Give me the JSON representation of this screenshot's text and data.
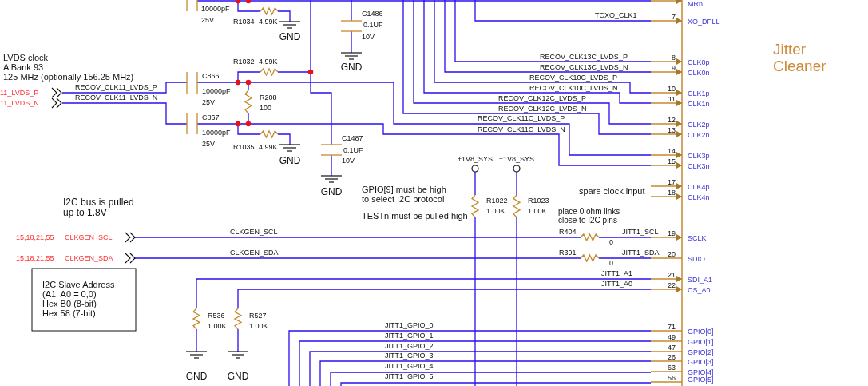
{
  "chip": {
    "title_lines": [
      "Jitter",
      "Cleaner"
    ],
    "pins": [
      {
        "name": "MRn",
        "kind": "input"
      },
      {
        "number": "7",
        "name": "XO_DPLL",
        "kind": "input"
      },
      {
        "number": "8",
        "name": "CLK0p",
        "kind": "input"
      },
      {
        "number": "9",
        "name": "CLK0n",
        "kind": "input"
      },
      {
        "number": "10",
        "name": "CLK1p",
        "kind": "input"
      },
      {
        "number": "11",
        "name": "CLK1n",
        "kind": "input"
      },
      {
        "number": "12",
        "name": "CLK2p",
        "kind": "input"
      },
      {
        "number": "13",
        "name": "CLK2n",
        "kind": "input"
      },
      {
        "number": "14",
        "name": "CLK3p",
        "kind": "input"
      },
      {
        "number": "15",
        "name": "CLK3n",
        "kind": "input"
      },
      {
        "number": "17",
        "name": "CLK4p",
        "kind": "input"
      },
      {
        "number": "18",
        "name": "CLK4n",
        "kind": "input"
      },
      {
        "number": "19",
        "name": "SCLK",
        "kind": "input"
      },
      {
        "number": "20",
        "name": "SDIO",
        "kind": "bidir"
      },
      {
        "number": "21",
        "name": "SDI_A1",
        "kind": "input"
      },
      {
        "number": "22",
        "name": "CS_A0",
        "kind": "input"
      },
      {
        "number": "71",
        "name": "GPIO[0]",
        "kind": "bidir"
      },
      {
        "number": "49",
        "name": "GPIO[1]",
        "kind": "bidir"
      },
      {
        "number": "47",
        "name": "GPIO[2]",
        "kind": "bidir"
      },
      {
        "number": "26",
        "name": "GPIO[3]",
        "kind": "bidir"
      },
      {
        "number": "63",
        "name": "GPIO[4]",
        "kind": "bidir"
      },
      {
        "number": "56",
        "name": "GPIO[5]",
        "kind": "bidir"
      }
    ]
  },
  "net_labels": [
    "TCXO_CLK1",
    "RECOV_CLK13C_LVDS_P",
    "RECOV_CLK13C_LVDS_N",
    "RECOV_CLK10C_LVDS_P",
    "RECOV_CLK10C_LVDS_N",
    "RECOV_CLK12C_LVDS_P",
    "RECOV_CLK12C_LVDS_N",
    "RECOV_CLK11C_LVDS_P",
    "RECOV_CLK11C_LVDS_N",
    "RECOV_CLK11_LVDS_P",
    "RECOV_CLK11_LVDS_N",
    "CLKGEN_SCL",
    "CLKGEN_SDA",
    "JITT1_SCL",
    "JITT1_SDA",
    "JITT1_A1",
    "JITT1_A0",
    "JITT1_GPIO_0",
    "JITT1_GPIO_1",
    "JITT1_GPIO_2",
    "JITT1_GPIO_3",
    "JITT1_GPIO_4",
    "JITT1_GPIO_5"
  ],
  "components": [
    {
      "kind": "resistor",
      "ref": "R1034",
      "value": "4.99K"
    },
    {
      "kind": "resistor",
      "ref": "R1032",
      "value": "4.99K"
    },
    {
      "kind": "resistor",
      "ref": "R208",
      "value": "100"
    },
    {
      "kind": "resistor",
      "ref": "R1035",
      "value": "4.99K"
    },
    {
      "kind": "resistor",
      "ref": "R1022",
      "value": "1.00K"
    },
    {
      "kind": "resistor",
      "ref": "R1023",
      "value": "1.00K"
    },
    {
      "kind": "resistor",
      "ref": "R404",
      "value": "0"
    },
    {
      "kind": "resistor",
      "ref": "R391",
      "value": "0"
    },
    {
      "kind": "resistor",
      "ref": "R536",
      "value": "1.00K"
    },
    {
      "kind": "resistor",
      "ref": "R527",
      "value": "1.00K"
    },
    {
      "kind": "capacitor",
      "value": "10000pF",
      "rating": "25V"
    },
    {
      "kind": "capacitor",
      "ref": "C866",
      "value": "10000pF",
      "rating": "25V"
    },
    {
      "kind": "capacitor",
      "ref": "C867",
      "value": "10000pF",
      "rating": "25V"
    },
    {
      "kind": "capacitor",
      "ref": "C1486",
      "value": "0.1UF",
      "rating": "10V"
    },
    {
      "kind": "capacitor",
      "ref": "C1487",
      "value": "0.1UF",
      "rating": "10V"
    }
  ],
  "grounds": [
    "GND",
    "GND",
    "GND",
    "GND",
    "GND",
    "GND"
  ],
  "power": [
    "+1V8_SYS",
    "+1V8_SYS"
  ],
  "offpage": [
    {
      "signal": "11_LVDS_P"
    },
    {
      "signal": "11_LVDS_N"
    },
    {
      "pages": "15,18,21,55",
      "signal": "CLKGEN_SCL"
    },
    {
      "pages": "15,18,21,55",
      "signal": "CLKGEN_SDA"
    }
  ],
  "notes": [
    {
      "lines": [
        "LVDS clock",
        "A Bank 93",
        "125 MHz (optionally 156.25 MHz)"
      ]
    },
    {
      "lines": [
        "I2C bus is pulled",
        "up to 1.8V"
      ]
    },
    {
      "lines": [
        "GPIO[9] must be high",
        "to select I2C protocol"
      ]
    },
    {
      "lines": [
        "TESTn must be pulled high"
      ]
    },
    {
      "lines": [
        "spare clock input"
      ]
    },
    {
      "lines": [
        "place 0 ohm links",
        "close to I2C pins"
      ]
    }
  ],
  "address_box": {
    "lines": [
      "I2C Slave Address",
      "(A1, A0 = 0,0)",
      "Hex B0 (8-bit)",
      "Hex 58 (7-bit)"
    ]
  }
}
